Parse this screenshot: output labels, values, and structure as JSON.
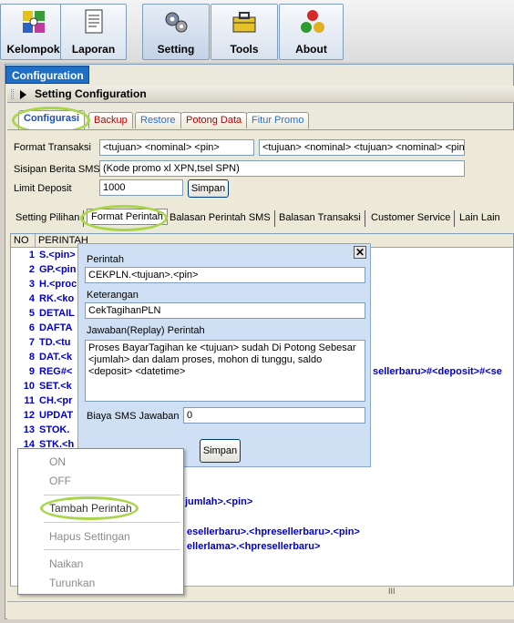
{
  "toolbar": {
    "buttons": [
      {
        "label": "Kelompok",
        "icon": "puzzle-icon"
      },
      {
        "label": "Laporan",
        "icon": "document-icon"
      },
      {
        "label": "Setting",
        "icon": "gears-icon"
      },
      {
        "label": "Tools",
        "icon": "toolbox-icon"
      },
      {
        "label": "About",
        "icon": "balls-icon"
      }
    ]
  },
  "window": {
    "tab": "Configuration",
    "panel_title": "Setting Configuration"
  },
  "tabs1": [
    "Configurasi",
    "Backup",
    "Restore",
    "Potong Data",
    "Fitur Promo"
  ],
  "form": {
    "format_transaksi_label": "Format Transaksi",
    "format_transaksi_1": "<tujuan> <nominal> <pin>",
    "format_transaksi_2": "<tujuan> <nominal> <tujuan> <nominal> <pin>",
    "sisipan_label": "Sisipan Berita SMS",
    "sisipan_value": "(Kode promo xl XPN,tsel SPN)",
    "limit_label": "Limit Deposit",
    "limit_value": "1000",
    "simpan": "Simpan"
  },
  "tabs2": [
    "Setting Pilihan",
    "Format Perintah",
    "Balasan Perintah SMS",
    "Balasan Transaksi",
    "Customer Service",
    "Lain Lain"
  ],
  "grid": {
    "col_no": "NO",
    "col_perintah": "PERINTAH",
    "rows": [
      {
        "no": "1",
        "cmd": "S.<pin>"
      },
      {
        "no": "2",
        "cmd": "GP.<pin"
      },
      {
        "no": "3",
        "cmd": "H.<proc"
      },
      {
        "no": "4",
        "cmd": "RK.<ko"
      },
      {
        "no": "5",
        "cmd": "DETAIL"
      },
      {
        "no": "6",
        "cmd": "DAFTA"
      },
      {
        "no": "7",
        "cmd": "TD.<tu"
      },
      {
        "no": "8",
        "cmd": "DAT.<k"
      },
      {
        "no": "9",
        "cmd": "REG#<"
      },
      {
        "no": "10",
        "cmd": "SET.<k"
      },
      {
        "no": "11",
        "cmd": "CH.<pr"
      },
      {
        "no": "12",
        "cmd": "UPDAT"
      },
      {
        "no": "13",
        "cmd": "STOK."
      },
      {
        "no": "14",
        "cmd": "STK.<h"
      }
    ],
    "row9_tail": "sellerbaru>#<deposit>#<se",
    "extra_rows": [
      "jumlah>.<pin>",
      "esellerbaru>.<hpresellerbaru>.<pin>",
      "ellerlama>.<hpresellerbaru>"
    ]
  },
  "dialog": {
    "perintah_label": "Perintah",
    "perintah_value": "CEKPLN.<tujuan>.<pin>",
    "keterangan_label": "Keterangan",
    "keterangan_value": "CekTagihanPLN",
    "jawaban_label": "Jawaban(Replay) Perintah",
    "jawaban_value": "Proses  BayarTagihan ke <tujuan> sudah Di Potong Sebesar <jumlah> dan dalam proses, mohon di tunggu, saldo <deposit> <datetime>",
    "biaya_label": "Biaya SMS Jawaban",
    "biaya_value": "0",
    "simpan": "Simpan",
    "close": "✕"
  },
  "context_menu": [
    "ON",
    "OFF",
    "Tambah Perintah",
    "Hapus Settingan",
    "Naikan",
    "Turunkan"
  ],
  "scrollbar_grip": "III",
  "colors": {
    "accent": "#1f6fc6",
    "highlight": "#a8d54a",
    "command": "#0000c0"
  }
}
